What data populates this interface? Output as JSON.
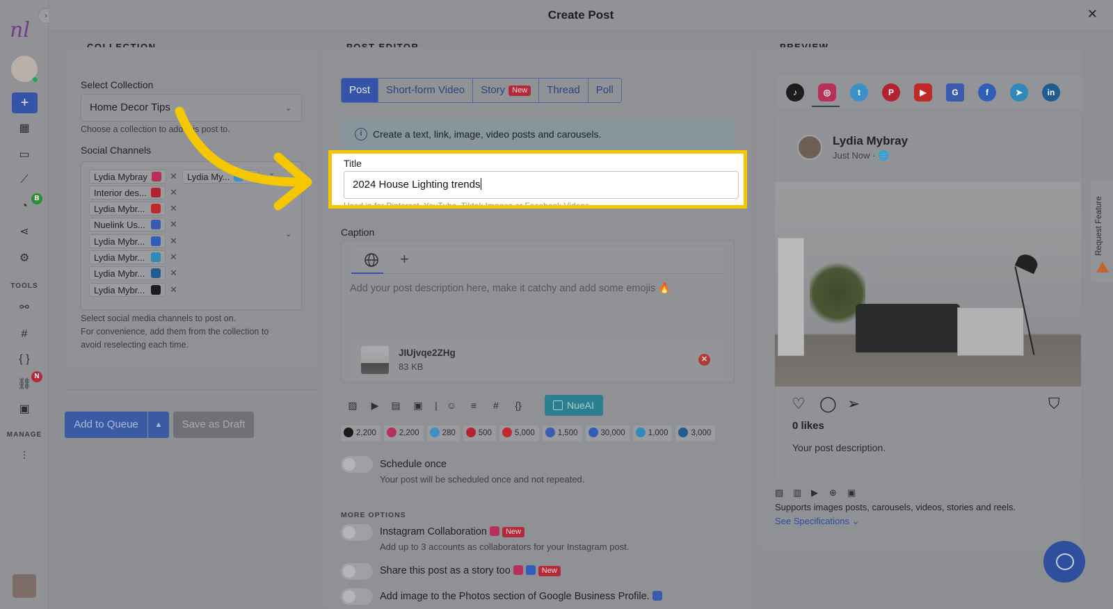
{
  "app": {
    "title": "Create Post",
    "logo_text": "nl",
    "collapse_glyph": "›",
    "close_glyph": "✕"
  },
  "nav": {
    "tools_label": "TOOLS",
    "manage_label": "MANAGE",
    "badge_b": "B",
    "badge_n": "N"
  },
  "collection": {
    "heading": "COLLECTION",
    "select_label": "Select Collection",
    "selected": "Home Decor Tips",
    "select_hint": "Choose a collection to add this post to.",
    "channels_label": "Social Channels",
    "channels": [
      {
        "name": "Lydia Mybray",
        "network": "instagram"
      },
      {
        "name": "Lydia My...",
        "network": "twitter"
      },
      {
        "name": "Interior des...",
        "network": "pinterest"
      },
      {
        "name": "Lydia Mybr...",
        "network": "youtube"
      },
      {
        "name": "Nuelink Us...",
        "network": "google-business"
      },
      {
        "name": "Lydia Mybr...",
        "network": "facebook"
      },
      {
        "name": "Lydia Mybr...",
        "network": "telegram"
      },
      {
        "name": "Lydia Mybr...",
        "network": "linkedin"
      },
      {
        "name": "Lydia Mybr...",
        "network": "tiktok"
      }
    ],
    "channels_hint_1": "Select social media channels to post on.",
    "channels_hint_2": "For convenience, add them from the collection to",
    "channels_hint_3": "avoid reselecting each time.",
    "add_to_queue": "Add to Queue",
    "save_draft": "Save as Draft"
  },
  "editor": {
    "heading": "POST EDITOR",
    "tabs": [
      {
        "label": "Post",
        "active": true
      },
      {
        "label": "Short-form Video"
      },
      {
        "label": "Story",
        "badge": "New"
      },
      {
        "label": "Thread"
      },
      {
        "label": "Poll"
      }
    ],
    "info_text": "Create a text, link, image, video posts and carousels.",
    "title_label": "Title",
    "title_value": "2024 House Lighting trends",
    "title_hint": "Used in for Pinterest, YouTube, Tiktok Images or Facebook Videos",
    "caption_label": "Caption",
    "caption_placeholder": "Add your post description here, make it catchy and add some emojis 🔥",
    "attachment": {
      "name": "JIUjvqe2ZHg",
      "size": "83 KB"
    },
    "nueai_label": "NueAI",
    "char_counts": [
      {
        "network": "tiktok",
        "value": "2,200",
        "color": "#1a1a1a"
      },
      {
        "network": "instagram",
        "value": "2,200",
        "color": "#b8305a"
      },
      {
        "network": "twitter",
        "value": "280",
        "color": "#3d8fc7"
      },
      {
        "network": "pinterest",
        "value": "500",
        "color": "#b3222f"
      },
      {
        "network": "youtube",
        "value": "5,000",
        "color": "#c0282a"
      },
      {
        "network": "google-business",
        "value": "1,500",
        "color": "#3b5bb0"
      },
      {
        "network": "facebook",
        "value": "30,000",
        "color": "#2f5fb8"
      },
      {
        "network": "telegram",
        "value": "1,000",
        "color": "#3089b8"
      },
      {
        "network": "linkedin",
        "value": "3,000",
        "color": "#1f5d91"
      }
    ],
    "schedule_title": "Schedule once",
    "schedule_sub": "Your post will be scheduled once and not repeated.",
    "more_options": "MORE OPTIONS",
    "collab_title": "Instagram Collaboration",
    "collab_sub": "Add up to 3 accounts as collaborators for your Instagram post.",
    "story_title": "Share this post as a story too",
    "gbp_title": "Add image to the Photos section of Google Business Profile.",
    "new_badge": "New"
  },
  "preview": {
    "heading": "PREVIEW",
    "platforms": [
      {
        "name": "tiktok",
        "glyph": "♪",
        "color": "#1c1c1c"
      },
      {
        "name": "instagram",
        "glyph": "◎",
        "color": "#b8305a",
        "selected": true
      },
      {
        "name": "twitter",
        "glyph": "t",
        "color": "#3d8fc7"
      },
      {
        "name": "pinterest",
        "glyph": "P",
        "color": "#b3222f"
      },
      {
        "name": "youtube",
        "glyph": "▶",
        "color": "#c0282a"
      },
      {
        "name": "google-business",
        "glyph": "G",
        "color": "#3b5bb0"
      },
      {
        "name": "facebook",
        "glyph": "f",
        "color": "#2f5fb8"
      },
      {
        "name": "telegram",
        "glyph": "➤",
        "color": "#3089b8"
      },
      {
        "name": "linkedin",
        "glyph": "in",
        "color": "#1f5d91"
      }
    ],
    "profile_name": "Lydia Mybray",
    "profile_time": "Just Now · 🌐",
    "likes": "0 likes",
    "description": "Your post description.",
    "supports": "Supports images posts, carousels, videos, stories and reels.",
    "see_specs": "See Specifications ⌄"
  },
  "side": {
    "request_feature": "Request Feature"
  }
}
